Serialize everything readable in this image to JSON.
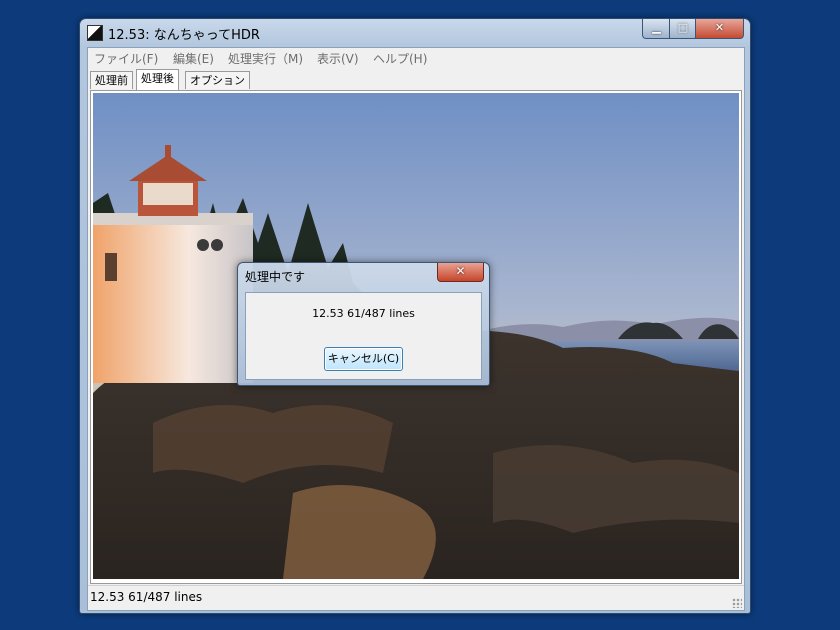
{
  "window": {
    "title": "12.53: なんちゃってHDR",
    "icon": "app-icon",
    "controls": {
      "minimize": "minimize-icon",
      "maximize": "maximize-icon",
      "close": "close-icon"
    }
  },
  "menubar": {
    "items": [
      "ファイル(F)",
      "編集(E)",
      "処理実行（M)",
      "表示(V)",
      "ヘルプ(H)"
    ]
  },
  "tabs": [
    {
      "label": "処理前",
      "active": false
    },
    {
      "label": "処理後",
      "active": true
    },
    {
      "label": "オプション",
      "active": false
    }
  ],
  "image": {
    "subject": "lighthouse-on-rocky-coast-photo"
  },
  "status": {
    "text": "12.53 61/487 lines"
  },
  "dialog": {
    "title": "処理中です",
    "message": "12.53 61/487 lines",
    "cancel_label": "キャンセル(C)"
  },
  "colors": {
    "desktop": "#0c3a7a",
    "window_frame": "#b2c6dd",
    "close_button": "#c6452c",
    "dialog_button": "#bee6fd"
  }
}
